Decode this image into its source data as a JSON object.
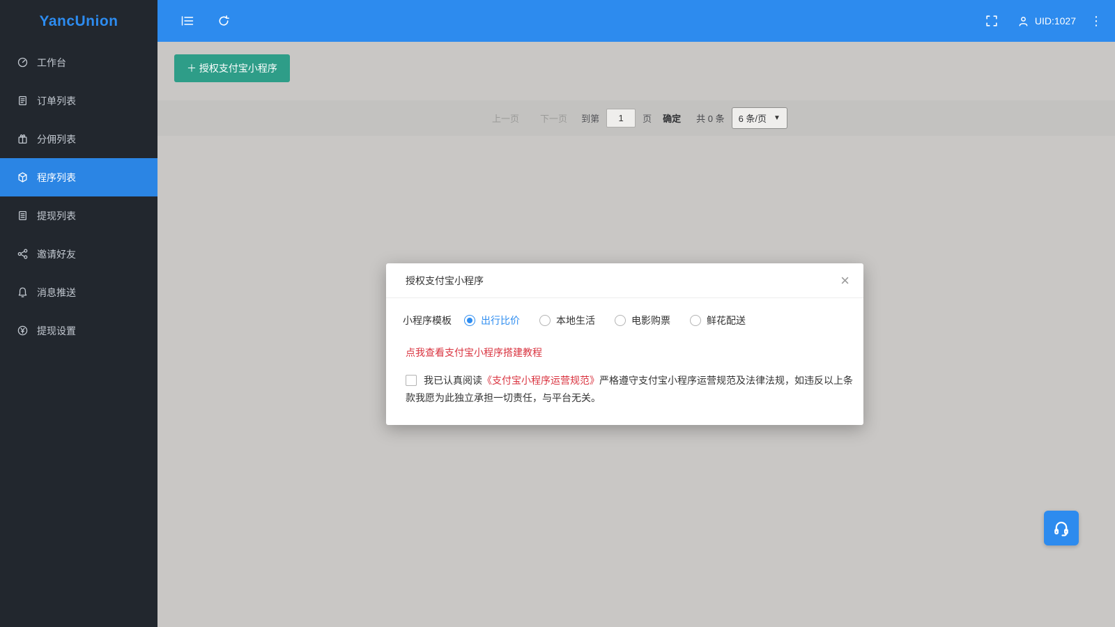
{
  "brand": "YancUnion",
  "topbar": {
    "uid": "UID:1027"
  },
  "sidebar": {
    "items": [
      {
        "label": "工作台",
        "icon": "dashboard-icon",
        "active": false
      },
      {
        "label": "订单列表",
        "icon": "order-list-icon",
        "active": false
      },
      {
        "label": "分佣列表",
        "icon": "commission-list-icon",
        "active": false
      },
      {
        "label": "程序列表",
        "icon": "program-list-icon",
        "active": true
      },
      {
        "label": "提现列表",
        "icon": "withdraw-list-icon",
        "active": false
      },
      {
        "label": "邀请好友",
        "icon": "invite-friends-icon",
        "active": false
      },
      {
        "label": "消息推送",
        "icon": "message-push-icon",
        "active": false
      },
      {
        "label": "提现设置",
        "icon": "withdraw-settings-icon",
        "active": false
      }
    ]
  },
  "content": {
    "authorize_button": "＋ 授权支付宝小程序",
    "pagination": {
      "prev": "上一页",
      "next": "下一页",
      "goto_prefix": "到第",
      "page_value": "1",
      "goto_suffix": "页",
      "confirm": "确定",
      "total": "共 0 条",
      "page_size": "6 条/页"
    }
  },
  "modal": {
    "title": "授权支付宝小程序",
    "close": "×",
    "template_label": "小程序模板",
    "options": [
      {
        "label": "出行比价",
        "selected": true
      },
      {
        "label": "本地生活",
        "selected": false
      },
      {
        "label": "电影购票",
        "selected": false
      },
      {
        "label": "鲜花配送",
        "selected": false
      }
    ],
    "tutorial_link": "点我查看支付宝小程序搭建教程",
    "agreement": {
      "prefix": "我已认真阅读",
      "link": "《支付宝小程序运营规范》",
      "suffix": "严格遵守支付宝小程序运营规范及法律法规，如违反以上条款我愿为此独立承担一切责任，与平台无关。"
    }
  },
  "colors": {
    "topbar_blue": "#2d8bee",
    "sidebar_dark": "#22272e",
    "active_blue": "#2b85e4",
    "brand_blue": "#2d8cf0",
    "button_green": "#2e9d88",
    "danger_red": "#d9333f"
  }
}
